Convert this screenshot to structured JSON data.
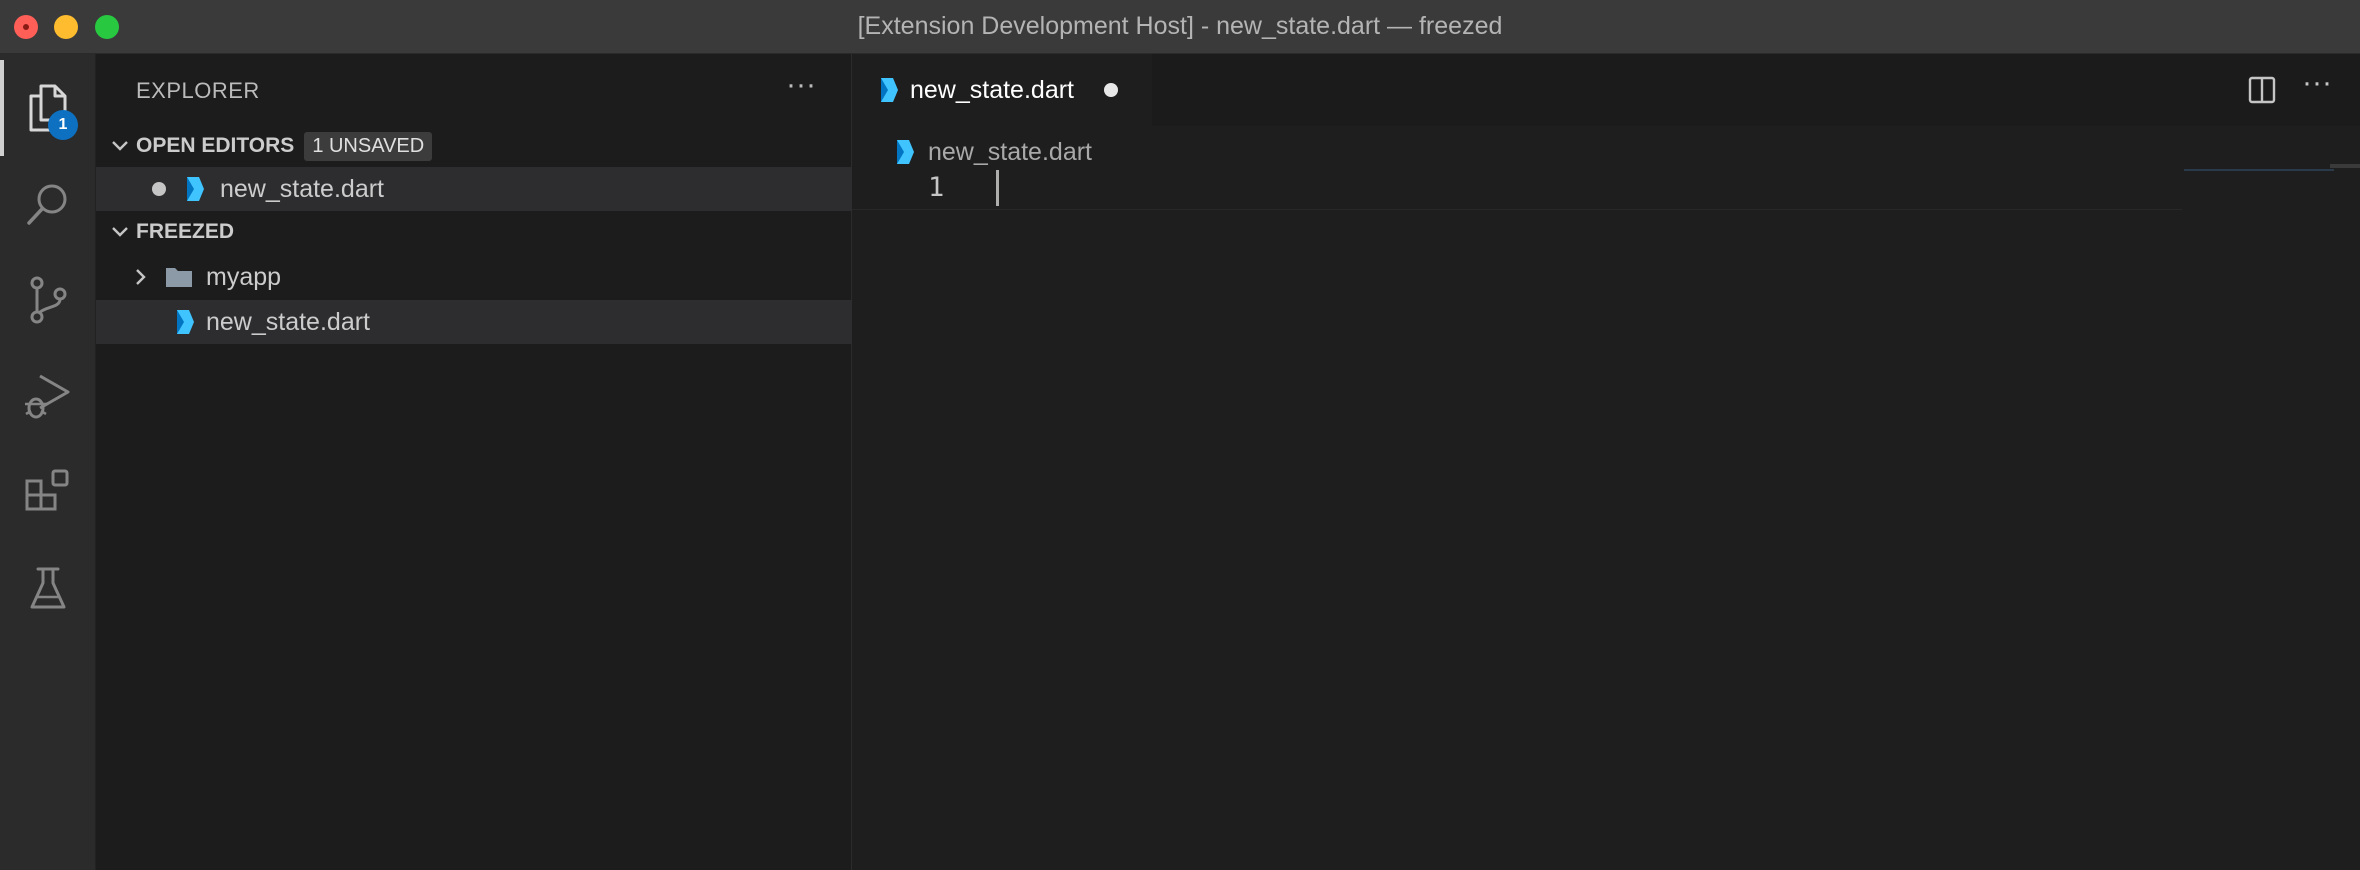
{
  "window": {
    "title": "[Extension Development Host] - new_state.dart — freezed"
  },
  "activity_bar": {
    "explorer_badge": "1",
    "items": [
      "explorer-icon",
      "search-icon",
      "source-control-icon",
      "run-debug-icon",
      "extensions-icon",
      "testing-icon"
    ]
  },
  "sidebar": {
    "header": "EXPLORER",
    "more": "···",
    "open_editors": {
      "title": "OPEN EDITORS",
      "badge": "1 UNSAVED",
      "items": [
        {
          "label": "new_state.dart",
          "dirty": true
        }
      ]
    },
    "workspace": {
      "title": "FREEZED",
      "items": [
        {
          "label": "myapp",
          "type": "folder"
        },
        {
          "label": "new_state.dart",
          "type": "file"
        }
      ]
    }
  },
  "editor": {
    "tab_label": "new_state.dart",
    "breadcrumb": "new_state.dart",
    "more": "···",
    "lines": [
      {
        "number": "1",
        "text": ""
      }
    ]
  },
  "colors": {
    "accent": "#0e70c0",
    "dart_blue": "#40c4ff",
    "dart_dark": "#0175c2"
  }
}
